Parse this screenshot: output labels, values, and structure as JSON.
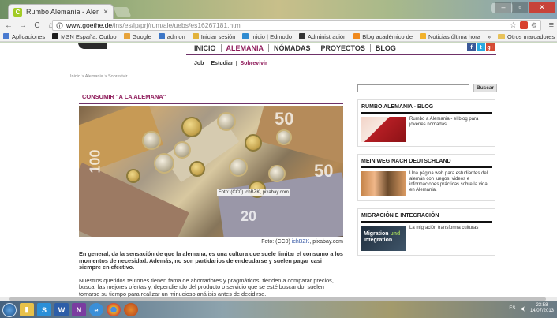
{
  "browser": {
    "tab_title": "Rumbo Alemania - Alem",
    "tab_close": "×",
    "url_host": "www.goethe.de",
    "url_path": "/ins/es/lp/prj/rum/ale/uebs/es16267181.htm",
    "nav": {
      "back": "←",
      "forward": "→",
      "reload": "C",
      "home": "⌂"
    },
    "window_controls": {
      "minimize": "–",
      "maximize": "▫",
      "close": "✕"
    }
  },
  "bookmarks": {
    "items": [
      {
        "label": "Aplicaciones",
        "color": "#4a7bd0"
      },
      {
        "label": "MSN España: Outloo",
        "color": "#1c1c1c"
      },
      {
        "label": "Google",
        "color": "#e7a33b"
      },
      {
        "label": "admon",
        "color": "#3c76c6"
      },
      {
        "label": "Iniciar sesión",
        "color": "#e2b23b"
      },
      {
        "label": "Inicio | Edmodo",
        "color": "#2f8bd1"
      },
      {
        "label": "Administración",
        "color": "#333333"
      },
      {
        "label": "Blog académico de",
        "color": "#f08a1f"
      },
      {
        "label": "Noticias última hora",
        "color": "#f2b22c"
      }
    ],
    "more": "»",
    "other": "Otros marcadores"
  },
  "site": {
    "main_nav": [
      "INICIO",
      "ALEMANIA",
      "NÓMADAS",
      "PROYECTOS",
      "BLOG"
    ],
    "active_nav": "ALEMANIA",
    "social": [
      "f",
      "t",
      "g+"
    ],
    "sub_nav": [
      "Job",
      "Estudiar",
      "Sobrevivir"
    ],
    "breadcrumb": "Inicio  >  Alemania  >  Sobrevivir"
  },
  "article": {
    "title": "CONSUMIR \"A LA ALEMANA\"",
    "photo_watermark": "Foto: (CC0) ichBZK, pixabay.com",
    "photo_numbers": [
      "50",
      "100",
      "50",
      "20"
    ],
    "caption_prefix": "Foto: (CC0) ",
    "caption_source": "ichBZK",
    "caption_suffix": ", pixabay.com",
    "para1": "En general, da la sensación de que la alemana, es una cultura que suele limitar el consumo a los momentos de necesidad. Además, no son partidarios de endeudarse y suelen pagar casi siempre en efectivo.",
    "para2": "Nuestros queridos teutones tienen fama de ahorradores y pragmáticos, tienden a comparar precios, buscar las mejores ofertas y, dependiendo del producto o servicio que se esté buscando, suelen tomarse su tiempo para realizar un minucioso análisis antes de decidirse."
  },
  "sidebar": {
    "search_button": "Buscar",
    "boxes": [
      {
        "title": "RUMBO ALEMANIA - BLOG",
        "text": "Rumbo a Alemania - el blog para jóvenes nómadas"
      },
      {
        "title": "MEIN WEG NACH DEUTSCHLAND",
        "text": "Una página web para estudiantes del alemán con juegos, videos e informaciones prácticas sobre la vida en Alemania."
      },
      {
        "title": "MIGRACIÓN E INTEGRACIÓN",
        "text": "La migración transforma culturas",
        "thumb_line1": "Migration",
        "thumb_word": "und",
        "thumb_line2": "Integration"
      }
    ]
  },
  "taskbar": {
    "apps": [
      "Explorer",
      "S",
      "Word",
      "N",
      "IE",
      "Chrome",
      "Firefox"
    ],
    "lang": "ES",
    "time": "23:58",
    "date": "14/07/2013"
  }
}
